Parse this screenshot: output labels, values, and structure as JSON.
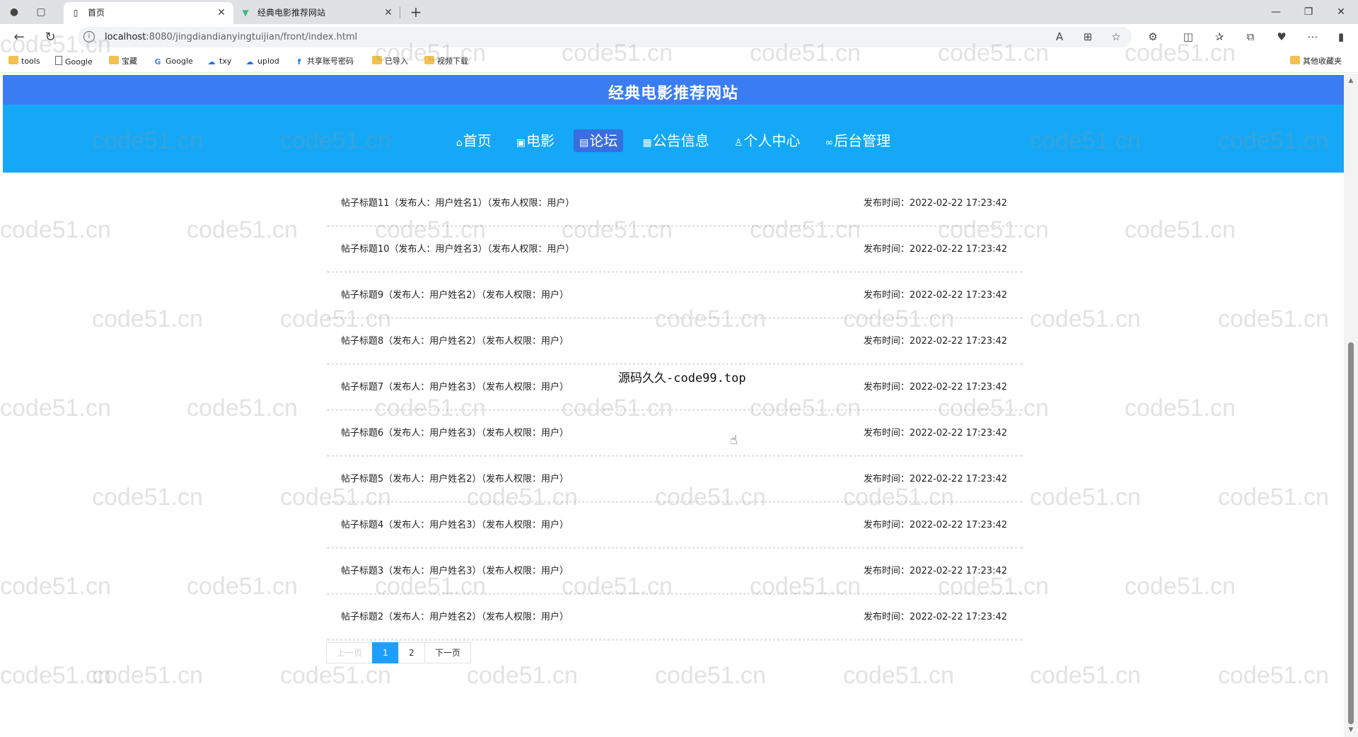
{
  "browser": {
    "tabs": [
      {
        "title": "首页",
        "active": true
      },
      {
        "title": "经典电影推荐网站",
        "active": false
      }
    ],
    "address": {
      "host": "localhost",
      "path": ":8080/jingdiandianyingtuijian/front/index.html"
    },
    "bookmarks": [
      {
        "label": "tools",
        "icon": "folder-icon"
      },
      {
        "label": "Google",
        "icon": "page-icon"
      },
      {
        "label": "宝藏",
        "icon": "folder-icon"
      },
      {
        "label": "Google",
        "icon": "google-icon"
      },
      {
        "label": "txy",
        "icon": "cloud-icon"
      },
      {
        "label": "uplod",
        "icon": "cloud-icon"
      },
      {
        "label": "共享账号密码",
        "icon": "share-icon"
      },
      {
        "label": "已导入",
        "icon": "folder-icon"
      },
      {
        "label": "视频下载",
        "icon": "folder-icon"
      }
    ],
    "other_bookmarks": "其他收藏夹"
  },
  "site": {
    "title": "经典电影推荐网站",
    "nav": [
      {
        "label": "首页",
        "icon": "home-icon",
        "glyph": "⌂",
        "active": false
      },
      {
        "label": "电影",
        "icon": "film-icon",
        "glyph": "▣",
        "active": false
      },
      {
        "label": "论坛",
        "icon": "forum-icon",
        "glyph": "▤",
        "active": true
      },
      {
        "label": "公告信息",
        "icon": "notice-icon",
        "glyph": "▦",
        "active": false
      },
      {
        "label": "个人中心",
        "icon": "user-icon",
        "glyph": "♙",
        "active": false
      },
      {
        "label": "后台管理",
        "icon": "link-icon",
        "glyph": "∞",
        "active": false
      }
    ]
  },
  "posts": [
    {
      "title": "帖子标题11（发布人：用户姓名1）（发布人权限：用户）",
      "time": "发布时间：2022-02-22 17:23:42"
    },
    {
      "title": "帖子标题10（发布人：用户姓名3）（发布人权限：用户）",
      "time": "发布时间：2022-02-22 17:23:42"
    },
    {
      "title": "帖子标题9（发布人：用户姓名2）（发布人权限：用户）",
      "time": "发布时间：2022-02-22 17:23:42"
    },
    {
      "title": "帖子标题8（发布人：用户姓名2）（发布人权限：用户）",
      "time": "发布时间：2022-02-22 17:23:42"
    },
    {
      "title": "帖子标题7（发布人：用户姓名3）（发布人权限：用户）",
      "time": "发布时间：2022-02-22 17:23:42"
    },
    {
      "title": "帖子标题6（发布人：用户姓名3）（发布人权限：用户）",
      "time": "发布时间：2022-02-22 17:23:42"
    },
    {
      "title": "帖子标题5（发布人：用户姓名2）（发布人权限：用户）",
      "time": "发布时间：2022-02-22 17:23:42"
    },
    {
      "title": "帖子标题4（发布人：用户姓名3）（发布人权限：用户）",
      "time": "发布时间：2022-02-22 17:23:42"
    },
    {
      "title": "帖子标题3（发布人：用户姓名3）（发布人权限：用户）",
      "time": "发布时间：2022-02-22 17:23:42"
    },
    {
      "title": "帖子标题2（发布人：用户姓名2）（发布人权限：用户）",
      "time": "发布时间：2022-02-22 17:23:42"
    }
  ],
  "pagination": {
    "prev": "上一页",
    "pages": [
      "1",
      "2"
    ],
    "current": "1",
    "next": "下一页"
  },
  "overlay_text": "源码久久-code99.top",
  "watermark": "code51.cn",
  "colors": {
    "title_bar": "#3a7cf2",
    "nav_bar": "#14a8f7",
    "nav_active": "#3a6ee0",
    "page_active": "#1e9fff"
  }
}
